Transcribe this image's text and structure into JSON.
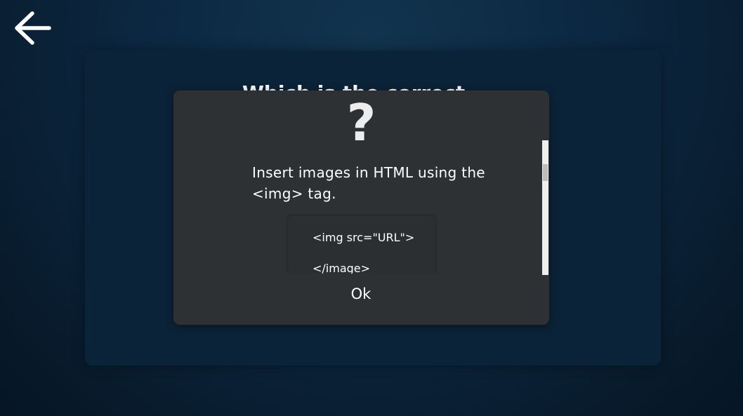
{
  "nav": {
    "back_icon": "arrow-left-icon"
  },
  "background": {
    "question_fragment": "Which is the correct"
  },
  "dialog": {
    "icon": "question-mark-icon",
    "icon_glyph": "?",
    "message": "Insert images in HTML using the <img> tag.",
    "code": {
      "line1": "<img src=\"URL\">",
      "line2": "</image>"
    },
    "ok_label": "Ok"
  },
  "colors": {
    "dialog_bg": "#2d3133",
    "page_bg": "#0c2740",
    "text": "#ffffff"
  }
}
